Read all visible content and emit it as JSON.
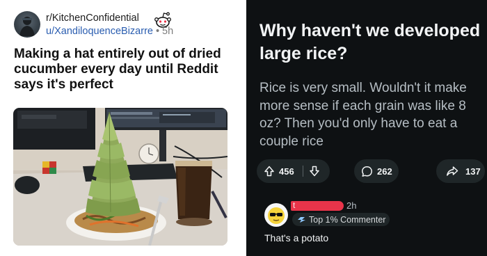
{
  "left_post": {
    "subreddit": "r/KitchenConfidential",
    "username": "u/XandiloquenceBizarre",
    "separator": "•",
    "age": "5h",
    "title": "Making a hat entirely out of dried cucumber every day until Reddit says it's perfect",
    "icons": {
      "avatar": "profile-avatar",
      "badge": "snoo-mascot-icon",
      "photo": "cucumber-hat-photo"
    }
  },
  "right_post": {
    "title": "Why haven't we developed large rice?",
    "body": "Rice is very small. Wouldn't it make more sense if each grain was like 8 oz? Then you'd only have to eat a couple rice",
    "actions": {
      "upvotes": "456",
      "comments": "262",
      "shares": "137"
    },
    "comment": {
      "author_initial": "t",
      "age": "2h",
      "flair": "Top 1% Commenter",
      "text": "That's a potato"
    }
  },
  "colors": {
    "dark_bg": "#0e1113",
    "pill_bg": "#1f2628",
    "username_blue": "#2a5db0",
    "redaction_red": "#e8344a"
  }
}
